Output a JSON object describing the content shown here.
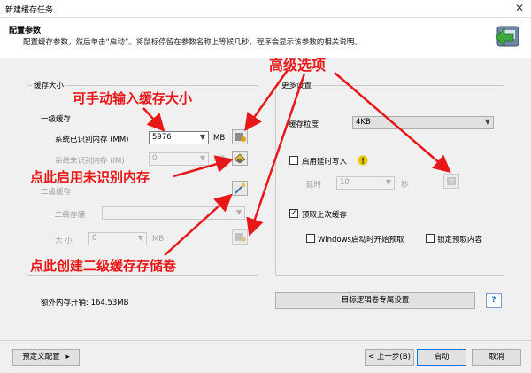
{
  "window": {
    "title": "新建缓存任务",
    "close_glyph": "✕"
  },
  "header": {
    "title": "配置参数",
    "description": "配置缓存参数，然后单击“启动”。将鼠标停留在参数名称上等候几秒，程序会显示该参数的相关说明。"
  },
  "cache_size": {
    "legend": "缓存大小",
    "level1": {
      "heading": "一级缓存",
      "identified_label": "系统已识别内存 (MM)",
      "identified_value": "5976",
      "unit": "MB",
      "unidentified_label": "系统未识别内存 (IM)",
      "unidentified_value": "0"
    },
    "level2": {
      "heading": "二级缓存",
      "storage_label": "二级存储",
      "storage_value": "",
      "size_label": "大 小",
      "size_value": "0",
      "unit": "MB"
    }
  },
  "more_settings": {
    "legend": "更多设置",
    "granularity_label": "缓存粒度",
    "granularity_value": "4KB",
    "delayed_write_label": "启用延时写入",
    "delay_label": "延时",
    "delay_value": "10",
    "delay_unit": "秒",
    "preload_label": "预取上次缓存",
    "win_start_preload_label": "Windows启动时开始预取",
    "lock_preload_label": "锁定预取内容"
  },
  "extra_memory": "额外内存开销: 164.53MB",
  "volume_settings_button": "目标逻辑卷专属设置",
  "help_glyph": "?",
  "footer": {
    "preset_button": "预定义配置",
    "preset_arrow": "▸",
    "back_button": "< 上一步(B)",
    "start_button": "启动",
    "cancel_button": "取消"
  },
  "annotations": {
    "manual_input": "可手动输入缓存大小",
    "advanced_options": "高级选项",
    "enable_unidentified": "点此启用未识别内存",
    "create_level2": "点此创建二级缓存存储卷"
  },
  "colors": {
    "annotation": "#e81818",
    "selection": "#0078d7",
    "hint": "#e6c400"
  }
}
